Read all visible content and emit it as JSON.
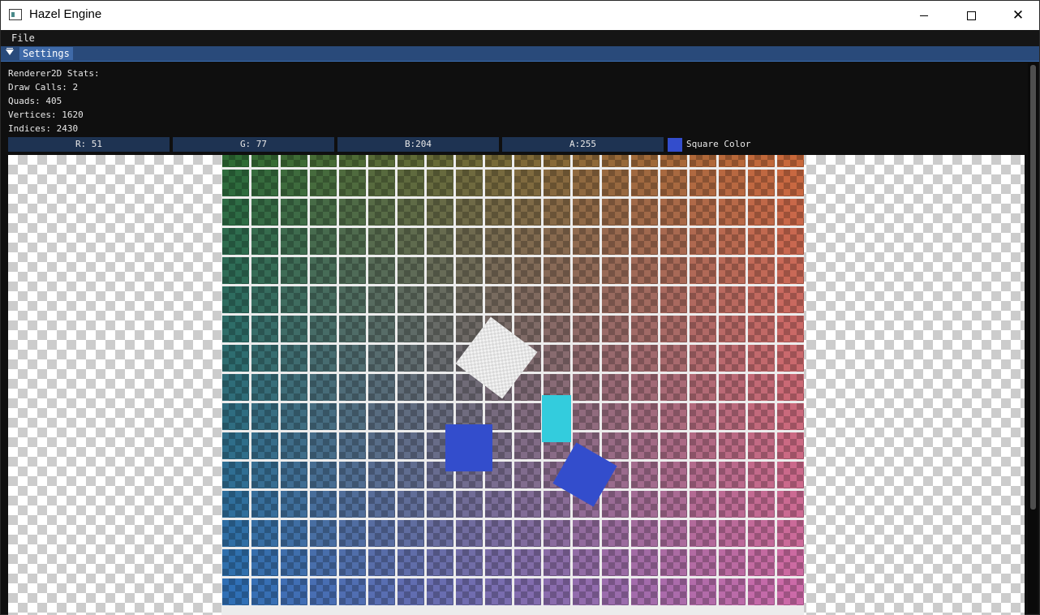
{
  "window": {
    "title": "Hazel Engine",
    "icon": "app-window-icon",
    "controls": {
      "minimize": "minimize-icon",
      "maximize": "maximize-icon",
      "close": "✕"
    }
  },
  "menu": {
    "file_label": "File"
  },
  "settings": {
    "title": "Settings",
    "collapse_icon": "triangle-down-icon",
    "stats_title": "Renderer2D Stats:",
    "draw_calls": "Draw Calls: 2",
    "quads": "Quads: 405",
    "vertices": "Vertices: 1620",
    "indices": "Indices: 2430",
    "color": {
      "r_label": "R: 51",
      "g_label": "G: 77",
      "b_label": "B:204",
      "a_label": "A:255",
      "label": "Square Color",
      "hex": "#334dcc"
    }
  },
  "scene": {
    "background": "checkerboard",
    "grid": {
      "rows": 16,
      "columns": 20,
      "color_top_left": "#2e6b34",
      "color_top_right": "#c8683a",
      "color_bottom_left": "#2f6fb5",
      "color_bottom_right": "#cc6aa8"
    },
    "cyan_quad_color": "#33ccdd",
    "square_color": "#334dcc"
  }
}
